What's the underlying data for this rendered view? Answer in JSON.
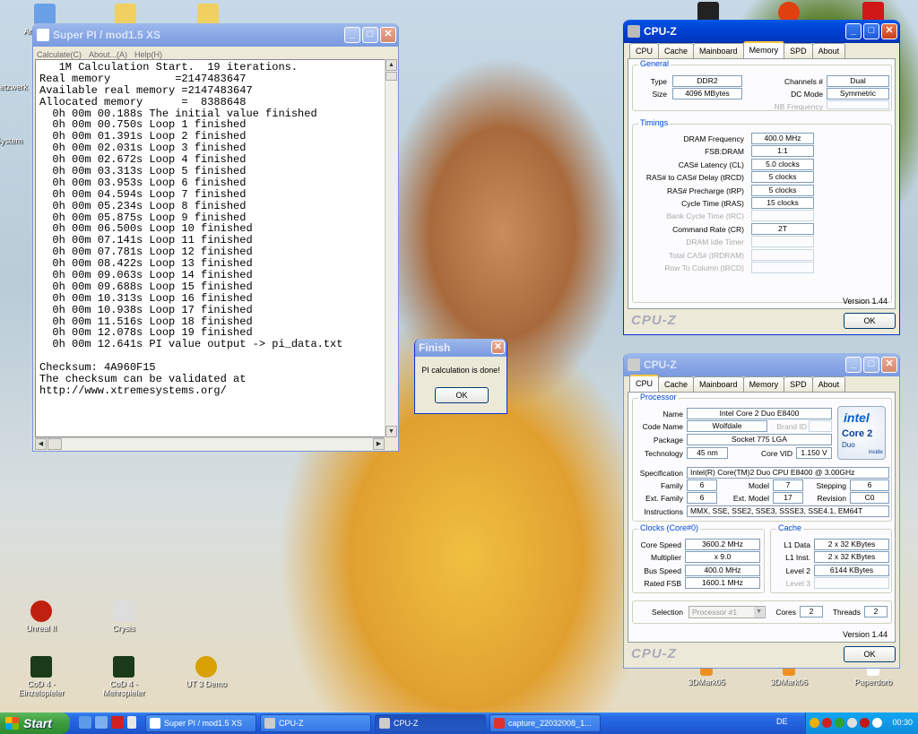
{
  "desktop_icons": [
    {
      "label": "Arbeitsplatz",
      "icon": "computer-icon"
    },
    {
      "label": "",
      "icon": "folder-icon"
    },
    {
      "label": "",
      "icon": "folder-icon"
    },
    {
      "label": "Netzwerk",
      "icon": "network-icon"
    },
    {
      "label": "System",
      "icon": "system-icon"
    },
    {
      "label": "Unreal II",
      "icon": "unreal-icon"
    },
    {
      "label": "Crysis",
      "icon": "crysis-icon"
    },
    {
      "label": "CoD 4 - Einzelspieler",
      "icon": "cod4-icon"
    },
    {
      "label": "CoD 4 - Mehrspieler",
      "icon": "cod4-multi-icon"
    },
    {
      "label": "UT 3 Demo",
      "icon": "ut3-icon"
    },
    {
      "label": "3DMark05",
      "icon": "3dmark-icon"
    },
    {
      "label": "3DMark06",
      "icon": "3dmark-icon"
    },
    {
      "label": "Paperdorb",
      "icon": "paper-icon"
    }
  ],
  "superpi": {
    "title": "Super PI / mod1.5 XS",
    "menu": [
      "Calculate(C)",
      "About...(A)",
      "Help(H)"
    ],
    "lines": [
      "   1M Calculation Start.  19 iterations.",
      "Real memory          =2147483647",
      "Available real memory =2147483647",
      "Allocated memory      =  8388648",
      "  0h 00m 00.188s The initial value finished",
      "  0h 00m 00.750s Loop 1 finished",
      "  0h 00m 01.391s Loop 2 finished",
      "  0h 00m 02.031s Loop 3 finished",
      "  0h 00m 02.672s Loop 4 finished",
      "  0h 00m 03.313s Loop 5 finished",
      "  0h 00m 03.953s Loop 6 finished",
      "  0h 00m 04.594s Loop 7 finished",
      "  0h 00m 05.234s Loop 8 finished",
      "  0h 00m 05.875s Loop 9 finished",
      "  0h 00m 06.500s Loop 10 finished",
      "  0h 00m 07.141s Loop 11 finished",
      "  0h 00m 07.781s Loop 12 finished",
      "  0h 00m 08.422s Loop 13 finished",
      "  0h 00m 09.063s Loop 14 finished",
      "  0h 00m 09.688s Loop 15 finished",
      "  0h 00m 10.313s Loop 16 finished",
      "  0h 00m 10.938s Loop 17 finished",
      "  0h 00m 11.516s Loop 18 finished",
      "  0h 00m 12.078s Loop 19 finished",
      "  0h 00m 12.641s PI value output -> pi_data.txt",
      "",
      "Checksum: 4A960F15",
      "The checksum can be validated at",
      "http://www.xtremesystems.org/"
    ]
  },
  "finish": {
    "title": "Finish",
    "message": "PI calculation is done!",
    "ok": "OK"
  },
  "cpuz_mem": {
    "title": "CPU-Z",
    "tabs": [
      "CPU",
      "Cache",
      "Mainboard",
      "Memory",
      "SPD",
      "About"
    ],
    "general_label": "General",
    "type_label": "Type",
    "type": "DDR2",
    "size_label": "Size",
    "size": "4096 MBytes",
    "channels_label": "Channels #",
    "channels": "Dual",
    "dcmode_label": "DC Mode",
    "dcmode": "Symmetric",
    "nbfreq_label": "NB Frequency",
    "timings_label": "Timings",
    "timings": [
      {
        "label": "DRAM Frequency",
        "value": "400.0 MHz"
      },
      {
        "label": "FSB:DRAM",
        "value": "1:1"
      },
      {
        "label": "CAS# Latency (CL)",
        "value": "5.0 clocks"
      },
      {
        "label": "RAS# to CAS# Delay (tRCD)",
        "value": "5 clocks"
      },
      {
        "label": "RAS# Precharge (tRP)",
        "value": "5 clocks"
      },
      {
        "label": "Cycle Time (tRAS)",
        "value": "15 clocks"
      },
      {
        "label": "Bank Cycle Time (tRC)",
        "value": ""
      },
      {
        "label": "Command Rate (CR)",
        "value": "2T"
      },
      {
        "label": "DRAM Idle Timer",
        "value": ""
      },
      {
        "label": "Total CAS# (tRDRAM)",
        "value": ""
      },
      {
        "label": "Row To Column (tRCD)",
        "value": ""
      }
    ],
    "version": "Version 1.44",
    "brand": "CPU-Z",
    "ok": "OK"
  },
  "cpuz_cpu": {
    "title": "CPU-Z",
    "tabs": [
      "CPU",
      "Cache",
      "Mainboard",
      "Memory",
      "SPD",
      "About"
    ],
    "processor_label": "Processor",
    "name_label": "Name",
    "name": "Intel Core 2 Duo E8400",
    "codename_label": "Code Name",
    "codename": "Wolfdale",
    "brandid_label": "Brand ID",
    "package_label": "Package",
    "package": "Socket 775 LGA",
    "tech_label": "Technology",
    "tech": "45 nm",
    "corevid_label": "Core VID",
    "corevid": "1.150 V",
    "spec_label": "Specification",
    "spec": "Intel(R) Core(TM)2 Duo CPU     E8400  @ 3.00GHz",
    "family_label": "Family",
    "family": "6",
    "model_label": "Model",
    "model": "7",
    "stepping_label": "Stepping",
    "stepping": "6",
    "extfamily_label": "Ext. Family",
    "extfamily": "6",
    "extmodel_label": "Ext. Model",
    "extmodel": "17",
    "revision_label": "Revision",
    "revision": "C0",
    "instr_label": "Instructions",
    "instr": "MMX, SSE, SSE2, SSE3, SSSE3, SSE4.1, EM64T",
    "clocks_label": "Clocks (Core#0)",
    "corespeed_label": "Core Speed",
    "corespeed": "3600.2 MHz",
    "mult_label": "Multiplier",
    "mult": "x 9.0",
    "bus_label": "Bus Speed",
    "bus": "400.0 MHz",
    "fsb_label": "Rated FSB",
    "fsb": "1600.1 MHz",
    "cache_label": "Cache",
    "l1d_label": "L1 Data",
    "l1d": "2 x 32 KBytes",
    "l1i_label": "L1 Inst.",
    "l1i": "2 x 32 KBytes",
    "l2_label": "Level 2",
    "l2": "6144 KBytes",
    "l3_label": "Level 3",
    "selection_label": "Selection",
    "selection": "Processor #1",
    "cores_label": "Cores",
    "cores": "2",
    "threads_label": "Threads",
    "threads": "2",
    "logo_intel": "intel",
    "logo_core": "Core 2",
    "logo_duo": "Duo",
    "logo_inside": "inside",
    "version": "Version 1.44",
    "brand": "CPU-Z",
    "ok": "OK"
  },
  "taskbar": {
    "start": "Start",
    "items": [
      "Super PI / mod1.5 XS",
      "CPU-Z",
      "CPU-Z",
      "capture_22032008_1..."
    ],
    "lang": "DE",
    "clock": "00:30"
  }
}
